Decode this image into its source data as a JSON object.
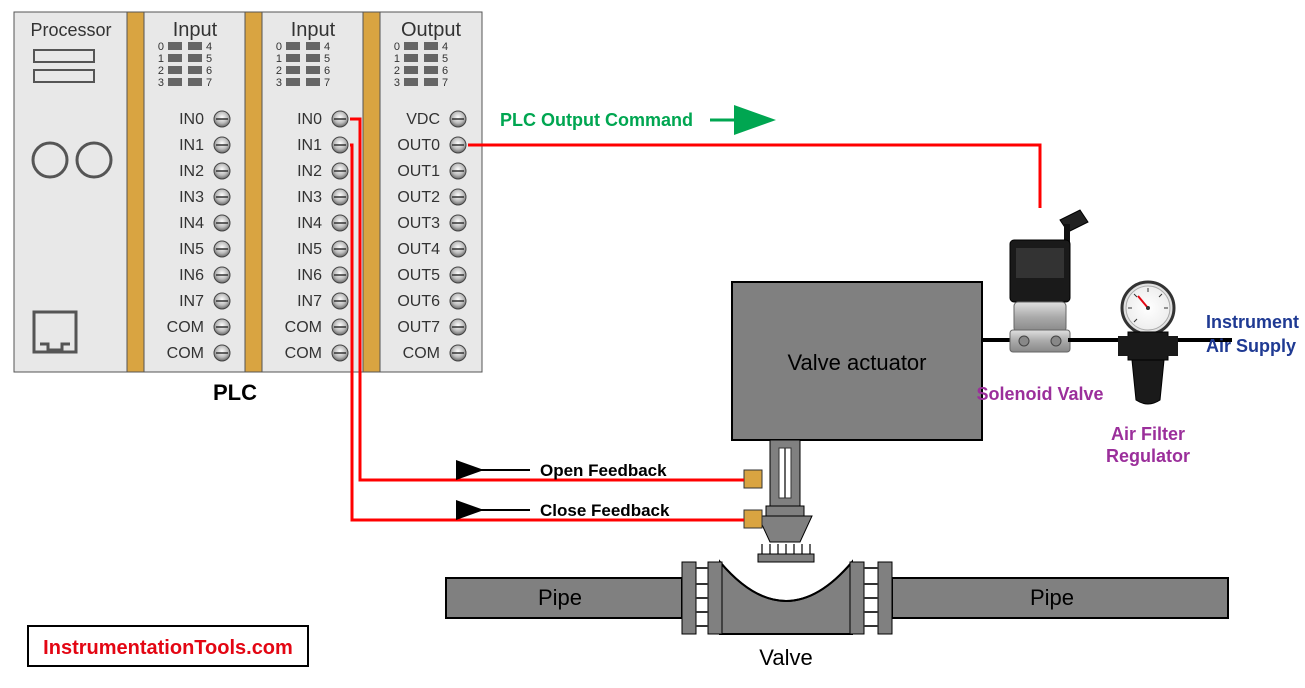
{
  "plc": {
    "caption": "PLC",
    "processor_label": "Processor",
    "modules": [
      {
        "header": "Input",
        "led_left": [
          "0",
          "1",
          "2",
          "3"
        ],
        "led_right": [
          "4",
          "5",
          "6",
          "7"
        ],
        "terminals": [
          "IN0",
          "IN1",
          "IN2",
          "IN3",
          "IN4",
          "IN5",
          "IN6",
          "IN7",
          "COM",
          "COM"
        ]
      },
      {
        "header": "Input",
        "led_left": [
          "0",
          "1",
          "2",
          "3"
        ],
        "led_right": [
          "4",
          "5",
          "6",
          "7"
        ],
        "terminals": [
          "IN0",
          "IN1",
          "IN2",
          "IN3",
          "IN4",
          "IN5",
          "IN6",
          "IN7",
          "COM",
          "COM"
        ]
      },
      {
        "header": "Output",
        "led_left": [
          "0",
          "1",
          "2",
          "3"
        ],
        "led_right": [
          "4",
          "5",
          "6",
          "7"
        ],
        "terminals": [
          "VDC",
          "OUT0",
          "OUT1",
          "OUT2",
          "OUT3",
          "OUT4",
          "OUT5",
          "OUT6",
          "OUT7",
          "COM"
        ]
      }
    ]
  },
  "annotations": {
    "output_command": "PLC Output Command",
    "open_feedback": "Open Feedback",
    "close_feedback": "Close Feedback",
    "valve_actuator": "Valve actuator",
    "solenoid_valve": "Solenoid Valve",
    "air_filter_regulator_l1": "Air Filter",
    "air_filter_regulator_l2": "Regulator",
    "instrument_air_l1": "Instrument",
    "instrument_air_l2": "Air Supply",
    "pipe_left": "Pipe",
    "pipe_right": "Pipe",
    "valve": "Valve",
    "watermark": "InstrumentationTools.com"
  },
  "colors": {
    "wire": "#ff0000",
    "module_bg": "#e8e8e8",
    "spacer": "#d9a441",
    "gray_body": "#808080",
    "dark_gray": "#595959",
    "green": "#00a651",
    "purple": "#9b2f9b",
    "blue": "#1f3a93",
    "red_text": "#e30613",
    "led": "#666666"
  }
}
